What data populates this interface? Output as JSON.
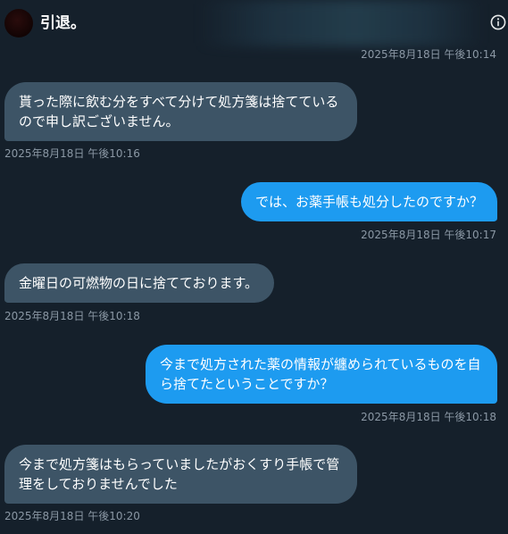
{
  "header": {
    "title": "引退。",
    "info_icon": "info-icon"
  },
  "colors": {
    "background": "#15202b",
    "incoming_bubble": "#3d5466",
    "outgoing_bubble": "#1d9bf0",
    "timestamp": "#8b98a5"
  },
  "messages": [
    {
      "timestamp": "2025年8月18日 午後10:14"
    },
    {
      "direction": "incoming",
      "lines": [
        "貰った際に飲む分をすべて分けて処方箋は捨てている",
        "ので申し訳ございません。"
      ],
      "timestamp": "2025年8月18日 午後10:16"
    },
    {
      "direction": "outgoing",
      "lines": [
        "では、お薬手帳も処分したのですか？"
      ],
      "timestamp": "2025年8月18日 午後10:17"
    },
    {
      "direction": "incoming",
      "lines": [
        "金曜日の可燃物の日に捨てております。"
      ],
      "timestamp": "2025年8月18日 午後10:18"
    },
    {
      "direction": "outgoing",
      "lines": [
        "今まで処方された薬の情報が纏められているものを自",
        "ら捨てたということですか？"
      ],
      "timestamp": "2025年8月18日 午後10:18"
    },
    {
      "direction": "incoming",
      "lines": [
        "今まで処方箋はもらっていましたがおくすり手帳で管",
        "理をしておりませんでした"
      ],
      "timestamp": "2025年8月18日 午後10:20"
    }
  ]
}
